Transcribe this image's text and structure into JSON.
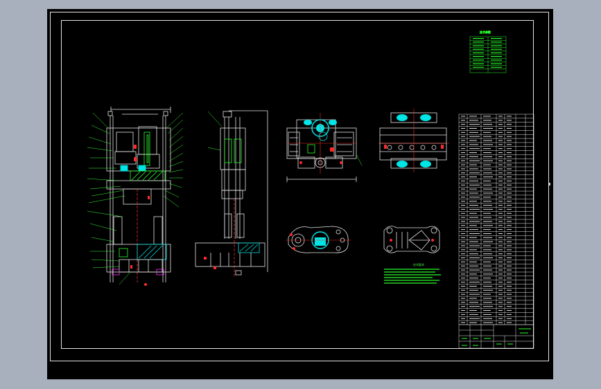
{
  "window": {
    "background": "#a9b0bd",
    "canvas_color": "#000000"
  },
  "colors": {
    "line": "#e6e6e6",
    "green": "#2bff2b",
    "cyan": "#00e5e5",
    "red": "#ff2a2a",
    "magenta": "#ff33ff",
    "yellow": "#e6e600",
    "blue": "#5a7cff"
  },
  "drawing": {
    "views": [
      "front-section-view",
      "side-section-view",
      "top-view",
      "bottom-view",
      "top-plate-view",
      "bottom-plate-view"
    ],
    "tech_notes_title": "技术要求",
    "parts_table": {
      "rows": 52
    },
    "spec_table": {
      "title": "技术参数",
      "rows": 10
    },
    "title_block": {
      "rows": 4
    }
  }
}
